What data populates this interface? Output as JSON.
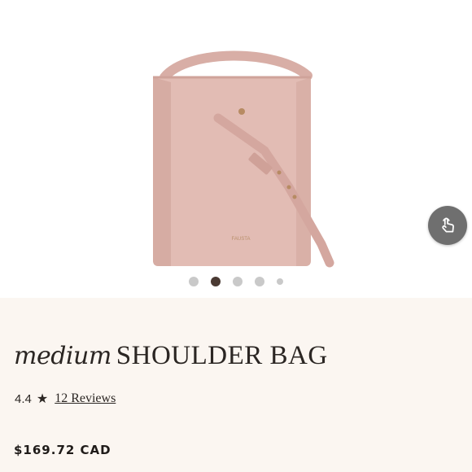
{
  "product": {
    "title_script": "medium",
    "title_main": "SHOULDER BAG",
    "rating": "4.4",
    "star_glyph": "★",
    "reviews_label": "12 Reviews",
    "price": "$169.72 CAD",
    "bag_color": "#e2bcb4"
  },
  "gallery": {
    "dots": [
      {
        "active": false
      },
      {
        "active": true
      },
      {
        "active": false
      },
      {
        "active": false
      },
      {
        "active": false
      }
    ],
    "touch_icon": "hand-tap-icon"
  }
}
